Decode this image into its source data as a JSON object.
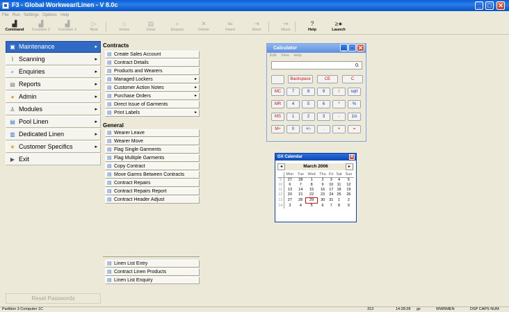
{
  "window": {
    "title": "F3 - Global Workwear/Linen - V 8.0c",
    "minimize": "_",
    "maximize": "□",
    "close": "✕"
  },
  "menubar": [
    "File",
    "Run",
    "Settings",
    "Options",
    "Help"
  ],
  "toolbar": [
    {
      "label": "Command",
      "icon": "command-icon",
      "glyph": "▟",
      "enabled": true
    },
    {
      "label": "Function 2",
      "icon": "function2-icon",
      "glyph": "▟",
      "enabled": false
    },
    {
      "label": "Function 3",
      "icon": "function3-icon",
      "glyph": "▟",
      "enabled": false
    },
    {
      "label": "Next",
      "icon": "next-icon",
      "glyph": "▷",
      "enabled": false
    },
    {
      "label": "Home",
      "icon": "home-icon",
      "glyph": "⌂",
      "enabled": false
    },
    {
      "label": "Clear",
      "icon": "clear-icon",
      "glyph": "▤",
      "enabled": false
    },
    {
      "label": "Enquiry",
      "icon": "enquiry-icon",
      "glyph": "⌕",
      "enabled": false
    },
    {
      "label": "Delete",
      "icon": "delete-icon",
      "glyph": "✕",
      "enabled": false
    },
    {
      "label": "Insert",
      "icon": "insert-icon",
      "glyph": "⇚",
      "enabled": false
    },
    {
      "label": "Abort",
      "icon": "abort-icon",
      "glyph": "⇥",
      "enabled": false
    },
    {
      "label": "Move",
      "icon": "move-icon",
      "glyph": "⇒",
      "enabled": false
    },
    {
      "label": "Help",
      "icon": "help-icon",
      "glyph": "?",
      "enabled": true
    },
    {
      "label": "Launch",
      "icon": "launch-icon",
      "glyph": "≥●",
      "enabled": true
    }
  ],
  "nav": [
    {
      "label": "Maintenance",
      "icon": "maintenance-icon",
      "glyph": "▣",
      "color": "#cc2222",
      "arrow": "▸",
      "active": true
    },
    {
      "label": "Scanning",
      "icon": "scanning-icon",
      "glyph": "⌇",
      "color": "#2a7a2a",
      "arrow": "▸",
      "active": false
    },
    {
      "label": "Enquiries",
      "icon": "enquiries-icon",
      "glyph": "⌕",
      "color": "#3a6fc4",
      "arrow": "▸",
      "active": false
    },
    {
      "label": "Reports",
      "icon": "reports-icon",
      "glyph": "▤",
      "color": "#777777",
      "arrow": "▸",
      "active": false
    },
    {
      "label": "Admin",
      "icon": "admin-icon",
      "glyph": "●",
      "color": "#d8a020",
      "arrow": "▸",
      "active": false
    },
    {
      "label": "Modules",
      "icon": "modules-icon",
      "glyph": "♙",
      "color": "#555555",
      "arrow": "▸",
      "active": false
    },
    {
      "label": "Pool Linen",
      "icon": "pool-linen-icon",
      "glyph": "▤",
      "color": "#3a6fc4",
      "arrow": "▸",
      "active": false
    },
    {
      "label": "Dedicated Linen",
      "icon": "dedicated-linen-icon",
      "glyph": "▥",
      "color": "#3a6fc4",
      "arrow": "▸",
      "active": false
    },
    {
      "label": "Customer Specifics",
      "icon": "customer-specifics-icon",
      "glyph": "★",
      "color": "#e0a020",
      "arrow": "▸",
      "active": false
    },
    {
      "label": "Exit",
      "icon": "exit-icon",
      "glyph": "▶",
      "color": "#555555",
      "arrow": "",
      "active": false
    }
  ],
  "reset_passwords": "Reset Passwords",
  "contracts": {
    "title": "Contracts",
    "items": [
      {
        "label": "Create Sales Account",
        "arrow": ""
      },
      {
        "label": "Contract Details",
        "arrow": ""
      },
      {
        "label": "Products and Wearers",
        "arrow": ""
      },
      {
        "label": "Managed Lockers",
        "arrow": "▸"
      },
      {
        "label": "Customer Action Notes",
        "arrow": "▸"
      },
      {
        "label": "Purchase Orders",
        "arrow": "▸"
      },
      {
        "label": "Direct Issue of Garments",
        "arrow": ""
      },
      {
        "label": "Print Labels",
        "arrow": "▸"
      }
    ]
  },
  "general": {
    "title": "General",
    "items": [
      {
        "label": "Wearer Leave",
        "arrow": ""
      },
      {
        "label": "Wearer Move",
        "arrow": ""
      },
      {
        "label": "Flag Single Garments",
        "arrow": ""
      },
      {
        "label": "Flag Multiple Garments",
        "arrow": ""
      },
      {
        "label": "Copy Contract",
        "arrow": ""
      },
      {
        "label": "Move Garms Between Contracts",
        "arrow": ""
      },
      {
        "label": "Contract Repairs",
        "arrow": ""
      },
      {
        "label": "Contract Repairs Report",
        "arrow": ""
      },
      {
        "label": "Contract Header Adjust",
        "arrow": ""
      }
    ]
  },
  "linen": {
    "items": [
      {
        "label": "Linen List Entry",
        "arrow": ""
      },
      {
        "label": "Contract Linen Products",
        "arrow": ""
      },
      {
        "label": "Linen List Enquiry",
        "arrow": ""
      }
    ]
  },
  "calculator": {
    "title": "Calculator",
    "menu": [
      "Edit",
      "View",
      "Help"
    ],
    "display": "0.",
    "buttons": [
      {
        "label": "Backspace",
        "row": 0,
        "col": 0,
        "span": 2,
        "red": true
      },
      {
        "label": "CE",
        "row": 0,
        "col": 2,
        "span": 1.5,
        "red": true
      },
      {
        "label": "C",
        "row": 0,
        "col": 3.5,
        "span": 1.5,
        "red": true
      },
      {
        "label": "MC",
        "row": 1,
        "col": 0,
        "red": true
      },
      {
        "label": "7",
        "row": 1,
        "col": 1
      },
      {
        "label": "8",
        "row": 1,
        "col": 2
      },
      {
        "label": "9",
        "row": 1,
        "col": 3
      },
      {
        "label": "/",
        "row": 1,
        "col": 4,
        "red": true
      },
      {
        "label": "sqrt",
        "row": 1,
        "col": 5
      },
      {
        "label": "MR",
        "row": 2,
        "col": 0,
        "red": true
      },
      {
        "label": "4",
        "row": 2,
        "col": 1
      },
      {
        "label": "5",
        "row": 2,
        "col": 2
      },
      {
        "label": "6",
        "row": 2,
        "col": 3
      },
      {
        "label": "*",
        "row": 2,
        "col": 4,
        "red": true
      },
      {
        "label": "%",
        "row": 2,
        "col": 5
      },
      {
        "label": "MS",
        "row": 3,
        "col": 0,
        "red": true
      },
      {
        "label": "1",
        "row": 3,
        "col": 1
      },
      {
        "label": "2",
        "row": 3,
        "col": 2
      },
      {
        "label": "3",
        "row": 3,
        "col": 3
      },
      {
        "label": "-",
        "row": 3,
        "col": 4,
        "red": true
      },
      {
        "label": "1/x",
        "row": 3,
        "col": 5
      },
      {
        "label": "M+",
        "row": 4,
        "col": 0,
        "red": true
      },
      {
        "label": "0",
        "row": 4,
        "col": 1
      },
      {
        "label": "+/-",
        "row": 4,
        "col": 2
      },
      {
        "label": ".",
        "row": 4,
        "col": 3
      },
      {
        "label": "+",
        "row": 4,
        "col": 4,
        "red": true
      },
      {
        "label": "=",
        "row": 4,
        "col": 5,
        "red": true
      }
    ]
  },
  "calendar": {
    "title": "GX Calendar",
    "month": "March 2006",
    "prev": "◂",
    "next": "▸",
    "close": "✕",
    "days": [
      "Mon",
      "Tue",
      "Wed",
      "Thu",
      "Fri",
      "Sat",
      "Sun"
    ],
    "today": "29",
    "weeks": [
      {
        "wk": "9",
        "d": [
          "27",
          "28",
          "1",
          "2",
          "3",
          "4",
          "5"
        ]
      },
      {
        "wk": "10",
        "d": [
          "6",
          "7",
          "8",
          "9",
          "10",
          "11",
          "12"
        ]
      },
      {
        "wk": "11",
        "d": [
          "13",
          "14",
          "15",
          "16",
          "17",
          "18",
          "19"
        ]
      },
      {
        "wk": "12",
        "d": [
          "20",
          "21",
          "22",
          "23",
          "24",
          "25",
          "26"
        ]
      },
      {
        "wk": "13",
        "d": [
          "27",
          "28",
          "29",
          "30",
          "31",
          "1",
          "2"
        ]
      },
      {
        "wk": "14",
        "d": [
          "3",
          "4",
          "5",
          "6",
          "7",
          "8",
          "9"
        ]
      }
    ]
  },
  "status": {
    "partition": "Partition 3 Computer 1C",
    "code": "313",
    "time": "14:28:28",
    "user": "gx",
    "station": "WWRMEN",
    "flags": "DSP CAPS NUM"
  }
}
